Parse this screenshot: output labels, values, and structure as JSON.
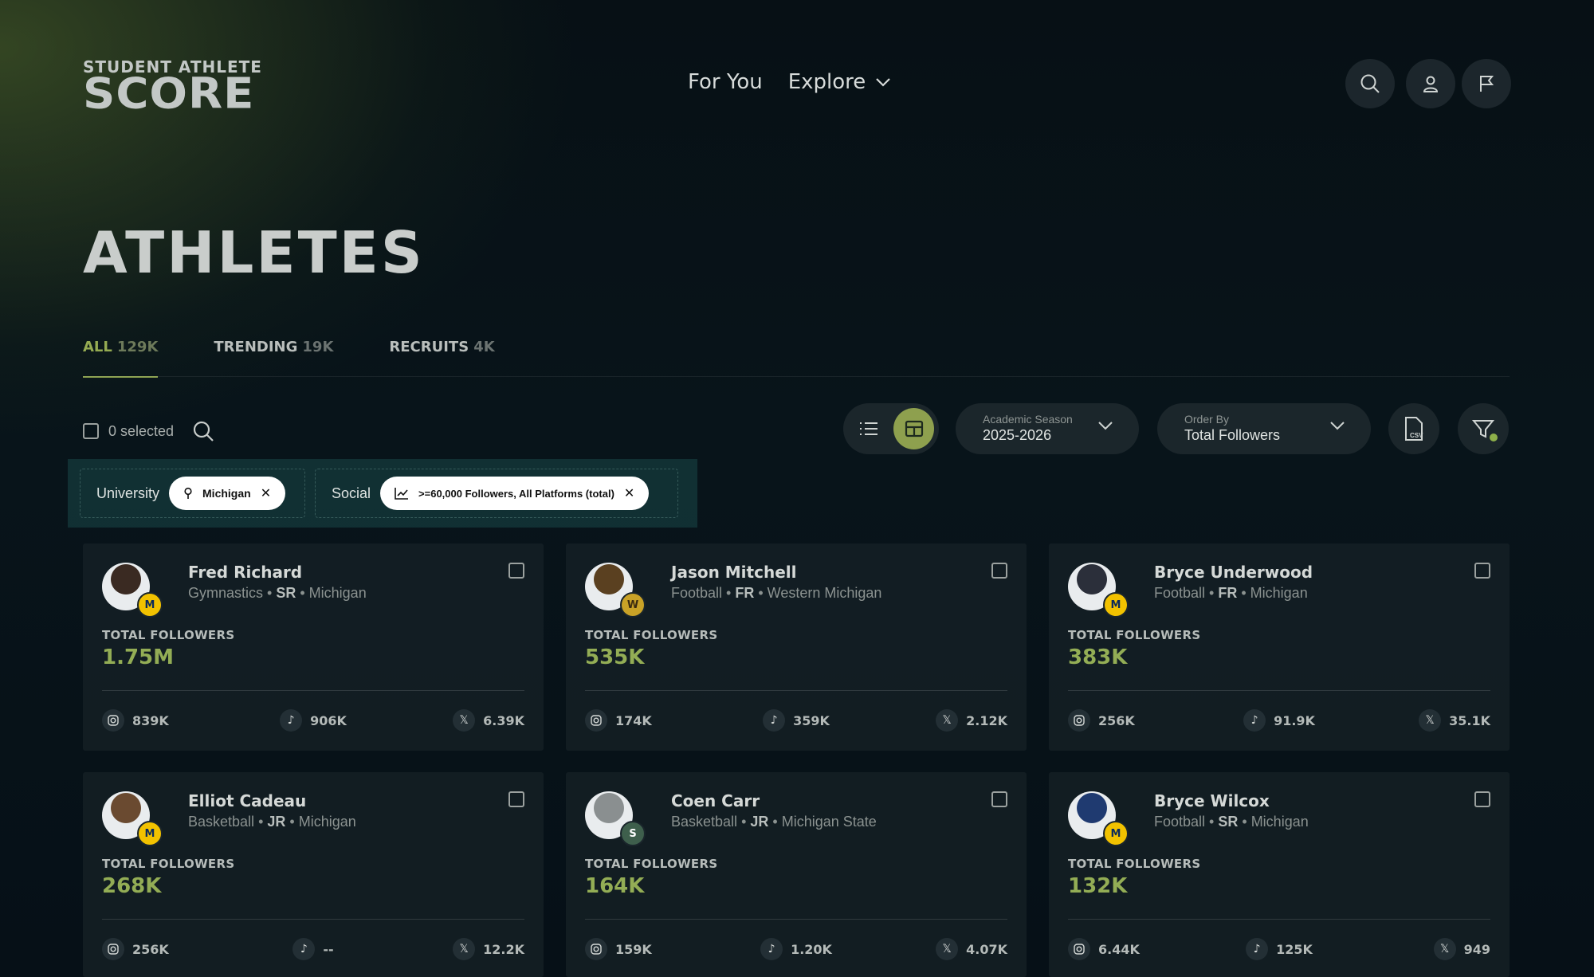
{
  "logo": {
    "line1": "STUDENT ATHLETE",
    "line2": "SCORE"
  },
  "nav": {
    "for_you": "For You",
    "explore": "Explore"
  },
  "page_title": "ATHLETES",
  "tabs": [
    {
      "label": "ALL",
      "count": "129K"
    },
    {
      "label": "TRENDING",
      "count": "19K"
    },
    {
      "label": "RECRUITS",
      "count": "4K"
    }
  ],
  "toolbar": {
    "selected": "0 selected",
    "season": {
      "label": "Academic Season",
      "value": "2025-2026"
    },
    "order": {
      "label": "Order By",
      "value": "Total Followers"
    },
    "csv": "CSV"
  },
  "filters": {
    "university_label": "University",
    "university_value": "Michigan",
    "social_label": "Social",
    "social_value": ">=60,000 Followers, All Platforms (total)"
  },
  "total_followers_label": "TOTAL FOLLOWERS",
  "athletes": [
    {
      "name": "Fred Richard",
      "sport": "Gymnastics",
      "year": "SR",
      "school": "Michigan",
      "total": "1.75M",
      "instagram": "839K",
      "tiktok": "906K",
      "x": "6.39K",
      "badge": "M"
    },
    {
      "name": "Jason Mitchell",
      "sport": "Football",
      "year": "FR",
      "school": "Western Michigan",
      "total": "535K",
      "instagram": "174K",
      "tiktok": "359K",
      "x": "2.12K",
      "badge": "W"
    },
    {
      "name": "Bryce Underwood",
      "sport": "Football",
      "year": "FR",
      "school": "Michigan",
      "total": "383K",
      "instagram": "256K",
      "tiktok": "91.9K",
      "x": "35.1K",
      "badge": "M"
    },
    {
      "name": "Elliot Cadeau",
      "sport": "Basketball",
      "year": "JR",
      "school": "Michigan",
      "total": "268K",
      "instagram": "256K",
      "tiktok": "--",
      "x": "12.2K",
      "badge": "M"
    },
    {
      "name": "Coen Carr",
      "sport": "Basketball",
      "year": "JR",
      "school": "Michigan State",
      "total": "164K",
      "instagram": "159K",
      "tiktok": "1.20K",
      "x": "4.07K",
      "badge": "S"
    },
    {
      "name": "Bryce Wilcox",
      "sport": "Football",
      "year": "SR",
      "school": "Michigan",
      "total": "132K",
      "instagram": "6.44K",
      "tiktok": "125K",
      "x": "949",
      "badge": "M"
    }
  ],
  "colors": {
    "accent": "#93ad55",
    "michigan_badge": "#f2c200",
    "wmu_badge": "#c9a227",
    "msu_badge": "#3e5f4c"
  }
}
